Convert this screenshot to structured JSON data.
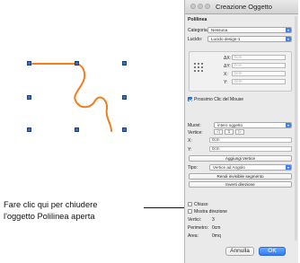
{
  "window": {
    "title": "Creazione Oggetto"
  },
  "section": {
    "title": "Polilinea"
  },
  "fields": {
    "category_label": "Categoria:",
    "category_value": "Nessuna",
    "lucido_label": "Lucido:",
    "lucido_value": "Lucido design-1",
    "dx_label": "ΔX:",
    "dx_value": "0cm",
    "dy_label": "ΔY:",
    "dy_value": "0cm",
    "x_label": "X:",
    "x_value": "0cm",
    "y_label": "Y:",
    "y_value": "0cm",
    "next_click_label": "Prossimo Clic del Mouse",
    "move_label": "Muovi:",
    "move_value": "intero oggetto",
    "vertex_label": "Vertice:",
    "vertex_nav": [
      "◁",
      "1",
      "▷"
    ],
    "vx_label": "X:",
    "vx_value": "0cm",
    "vy_label": "Y:",
    "vy_value": "0cm",
    "add_vertex": "Aggiungi Vertice",
    "type_label": "Tipo:",
    "type_value": "Vertice ad Angolo",
    "make_invisible": "Rendi invisibile segmento",
    "reverse_direction": "Inverti direzione",
    "closed_label": "Chiuso",
    "show_direction_label": "Mostra direzione",
    "vertices_label": "Vertici:",
    "vertices_value": "3",
    "perimeter_label": "Perimetro:",
    "perimeter_value": "0cm",
    "area_label": "Area:",
    "area_value": "0mq"
  },
  "buttons": {
    "cancel": "Annulla",
    "ok": "OK"
  },
  "callout": {
    "line1": "Fare clic qui per chiudere",
    "line2": "l'oggetto Polilinea aperta"
  },
  "colors": {
    "curve": "#f07e1e",
    "accent": "#2f7cf6",
    "handle": "#3f6fb8"
  },
  "icons": {
    "handle": "selection-handle-square",
    "check": "checkmark-icon",
    "arrow": "chevron-down-icon"
  }
}
